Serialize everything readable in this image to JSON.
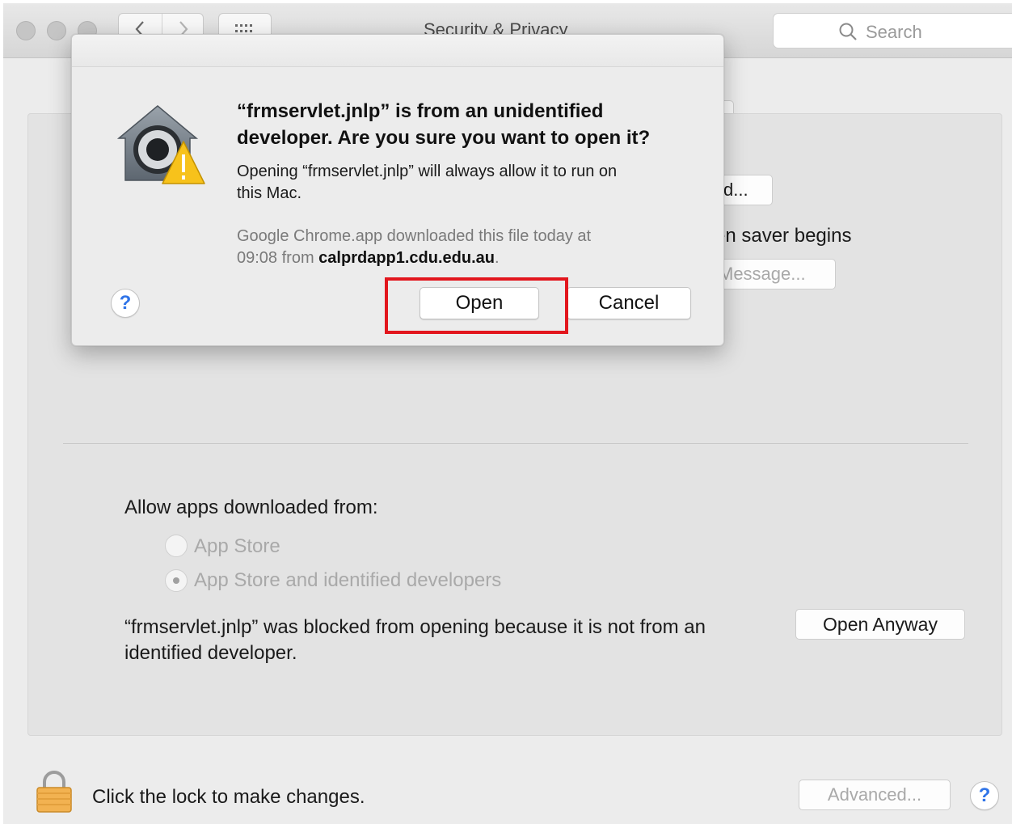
{
  "window": {
    "title": "Security & Privacy",
    "search_placeholder": "Search"
  },
  "background": {
    "partial_button_1": "d...",
    "partial_text": "en saver begins",
    "partial_button_2": "Message...",
    "allow_label": "Allow apps downloaded from:",
    "radio_options": [
      {
        "label": "App Store",
        "selected": false
      },
      {
        "label": "App Store and identified developers",
        "selected": true
      }
    ],
    "blocked_message_line1": "“frmservlet.jnlp” was blocked from opening because it is not from an",
    "blocked_message_line2": "identified developer.",
    "open_anyway_label": "Open Anyway"
  },
  "footer": {
    "lock_text": "Click the lock to make changes.",
    "advanced_label": "Advanced...",
    "help_label": "?"
  },
  "dialog": {
    "title_line1": "“frmservlet.jnlp” is from an unidentified",
    "title_line2": "developer. Are you sure you want to open it?",
    "message_line1": "Opening “frmservlet.jnlp” will always allow it to run on",
    "message_line2": "this Mac.",
    "info_line1": "Google Chrome.app downloaded this file today at",
    "info_line2_prefix": "09:08 from ",
    "info_host": "calprdapp1.cdu.edu.au",
    "info_suffix": ".",
    "help_label": "?",
    "open_label": "Open",
    "cancel_label": "Cancel",
    "highlight_color": "#e2161d"
  },
  "colors": {
    "window_bg": "#ececec",
    "help_blue": "#2f74e8",
    "disabled_text": "#a9a9a9"
  },
  "icons": [
    "back-icon",
    "forward-icon",
    "grid-icon",
    "search-icon",
    "gatekeeper-icon",
    "warning-icon",
    "lock-icon",
    "help-icon"
  ]
}
